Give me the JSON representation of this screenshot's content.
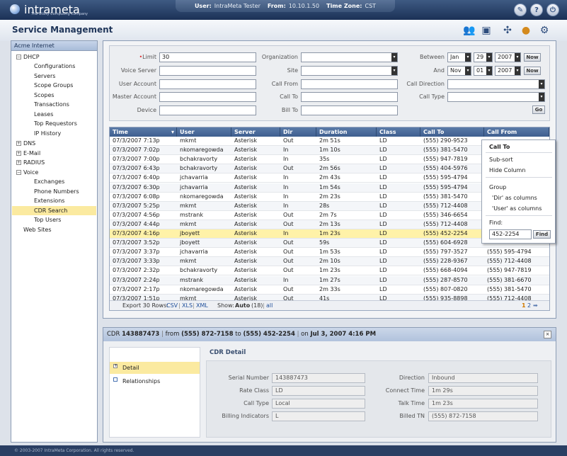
{
  "header": {
    "logo_text": "intrameta",
    "logo_tagline": "The Utility Computing Company",
    "user_label": "User:",
    "user_value": "IntraMeta Tester",
    "from_label": "From:",
    "from_value": "10.10.1.50",
    "tz_label": "Time Zone:",
    "tz_value": "CST"
  },
  "page": {
    "title": "Service Management"
  },
  "sidebar": {
    "header": "Acme Internet",
    "dhcp": "DHCP",
    "configurations": "Configurations",
    "servers": "Servers",
    "scope_groups": "Scope Groups",
    "scopes": "Scopes",
    "transactions": "Transactions",
    "leases": "Leases",
    "top_requestors": "Top Requestors",
    "ip_history": "IP History",
    "dns": "DNS",
    "email": "E-Mail",
    "radius": "RADIUS",
    "voice": "Voice",
    "exchanges": "Exchanges",
    "phone_numbers": "Phone Numbers",
    "extensions": "Extensions",
    "cdr_search": "CDR Search",
    "top_users": "Top Users",
    "web_sites": "Web Sites"
  },
  "filter": {
    "limit_label": "Limit",
    "limit_value": "30",
    "voice_server_label": "Voice Server",
    "user_account_label": "User Account",
    "master_account_label": "Master Account",
    "device_label": "Device",
    "organization_label": "Organization",
    "site_label": "Site",
    "call_from_label": "Call From",
    "call_to_label": "Call To",
    "bill_to_label": "Bill To",
    "between_label": "Between",
    "between_month": "Jan",
    "between_day": "29",
    "between_year": "2007",
    "and_label": "And",
    "and_month": "Nov",
    "and_day": "01",
    "and_year": "2007",
    "now_label": "Now",
    "call_direction_label": "Call Direction",
    "call_type_label": "Call Type",
    "go_label": "Go"
  },
  "grid": {
    "columns": [
      "Time",
      "User",
      "Server",
      "Dir",
      "Duration",
      "Class",
      "Call To",
      "Call From"
    ],
    "rows": [
      [
        "07/3/2007 7:13p",
        "mkmt",
        "Asterisk",
        "Out",
        "2m 51s",
        "LD",
        "(555) 290-9523",
        ""
      ],
      [
        "07/3/2007 7:02p",
        "nkomaregowda",
        "Asterisk",
        "In",
        "1m 10s",
        "LD",
        "(555) 381-5470",
        ""
      ],
      [
        "07/3/2007 7:00p",
        "bchakravorty",
        "Asterisk",
        "In",
        "35s",
        "LD",
        "(555) 947-7819",
        ""
      ],
      [
        "07/3/2007 6:43p",
        "bchakravorty",
        "Asterisk",
        "Out",
        "2m 56s",
        "LD",
        "(555) 404-5976",
        ""
      ],
      [
        "07/3/2007 6:40p",
        "jchavarria",
        "Asterisk",
        "In",
        "2m 43s",
        "LD",
        "(555) 595-4794",
        ""
      ],
      [
        "07/3/2007 6:30p",
        "jchavarria",
        "Asterisk",
        "In",
        "1m 54s",
        "LD",
        "(555) 595-4794",
        ""
      ],
      [
        "07/3/2007 6:08p",
        "nkomaregowda",
        "Asterisk",
        "In",
        "2m 23s",
        "LD",
        "(555) 381-5470",
        ""
      ],
      [
        "07/3/2007 5:25p",
        "mkmt",
        "Asterisk",
        "In",
        "28s",
        "LD",
        "(555) 712-4408",
        ""
      ],
      [
        "07/3/2007 4:56p",
        "mstrank",
        "Asterisk",
        "Out",
        "2m 7s",
        "LD",
        "(555) 346-6654",
        ""
      ],
      [
        "07/3/2007 4:44p",
        "mkmt",
        "Asterisk",
        "Out",
        "2m 13s",
        "LD",
        "(555) 712-4408",
        ""
      ],
      [
        "07/3/2007 4:16p",
        "jboyett",
        "Asterisk",
        "In",
        "1m 23s",
        "LD",
        "(555) 452-2254",
        ""
      ],
      [
        "07/3/2007 3:52p",
        "jboyett",
        "Asterisk",
        "Out",
        "59s",
        "LD",
        "(555) 604-6928",
        ""
      ],
      [
        "07/3/2007 3:37p",
        "jchavarria",
        "Asterisk",
        "Out",
        "1m 53s",
        "LD",
        "(555) 797-3527",
        "(555) 595-4794"
      ],
      [
        "07/3/2007 3:33p",
        "mkmt",
        "Asterisk",
        "Out",
        "2m 10s",
        "LD",
        "(555) 228-9367",
        "(555) 712-4408"
      ],
      [
        "07/3/2007 2:32p",
        "bchakravorty",
        "Asterisk",
        "Out",
        "1m 23s",
        "LD",
        "(555) 668-4094",
        "(555) 947-7819"
      ],
      [
        "07/3/2007 2:24p",
        "mstrank",
        "Asterisk",
        "In",
        "1m 27s",
        "LD",
        "(555) 287-8570",
        "(555) 381-6670"
      ],
      [
        "07/3/2007 2:17p",
        "nkomaregowda",
        "Asterisk",
        "Out",
        "2m 33s",
        "LD",
        "(555) 807-0820",
        "(555) 381-5470"
      ],
      [
        "07/3/2007 1:51p",
        "mkmt",
        "Asterisk",
        "Out",
        "41s",
        "LD",
        "(555) 935-8898",
        "(555) 712-4408"
      ]
    ],
    "footer_export": "Export 30 Rows:",
    "csv": "CSV",
    "xls": "XLS",
    "xml": "XML",
    "show_label": "Show:",
    "show_auto": "Auto",
    "show_count": "(18)",
    "show_all": "all",
    "page1": "1",
    "page2": "2"
  },
  "popup": {
    "title": "Call To",
    "subsort": "Sub-sort",
    "hide_column": "Hide Column",
    "group": "Group",
    "group_dir": "'Dir' as columns",
    "group_user": "'User' as columns",
    "find_label": "Find:",
    "find_value": "452-2254",
    "find_button": "Find"
  },
  "detail": {
    "cdr_label": "CDR",
    "cdr_id": "143887473",
    "from_label": "from",
    "from_value": "(555) 872-7158",
    "to_label": "to",
    "to_value": "(555) 452-2254",
    "on_label": "on",
    "on_value": "Jul 3, 2007 4:16 PM",
    "section_title": "CDR Detail",
    "tab_detail": "Detail",
    "tab_relationships": "Relationships",
    "serial_label": "Serial Number",
    "serial_value": "143887473",
    "rate_label": "Rate Class",
    "rate_value": "LD",
    "calltype_label": "Call Type",
    "calltype_value": "Local",
    "billing_label": "Billing Indicators",
    "billing_value": "L",
    "direction_label": "Direction",
    "direction_value": "Inbound",
    "connect_label": "Connect Time",
    "connect_value": "1m 29s",
    "talk_label": "Talk Time",
    "talk_value": "1m 23s",
    "billed_label": "Billed TN",
    "billed_value": "(555) 872-7158"
  },
  "footer": {
    "copyright": "© 2003-2007 IntraMeta Corporation.  All rights reserved."
  }
}
